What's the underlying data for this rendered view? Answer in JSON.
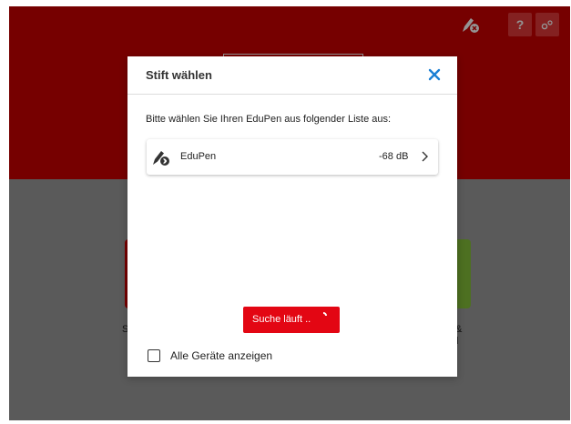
{
  "header": {
    "help_label": "?",
    "icons": {
      "pen": "pen-disconnected-icon",
      "settings": "settings-gears-icon"
    }
  },
  "background": {
    "left_tile_label": "S",
    "right_tile_label_1": "&",
    "right_tile_label_2": "l"
  },
  "dialog": {
    "title": "Stift wählen",
    "close_icon": "close-icon",
    "instruction": "Bitte wählen Sie Ihren EduPen aus folgender Liste aus:",
    "devices": [
      {
        "name": "EduPen",
        "rssi": "-68 dB",
        "icon": "pen-bluetooth-icon"
      }
    ],
    "search_button_label": "Suche läuft ..",
    "show_all_label": "Alle Geräte anzeigen",
    "show_all_checked": false
  },
  "colors": {
    "brand_red": "#cc0000",
    "button_red": "#e30613",
    "accent_blue": "#1a7fd4",
    "tile_green": "#86c23a"
  }
}
